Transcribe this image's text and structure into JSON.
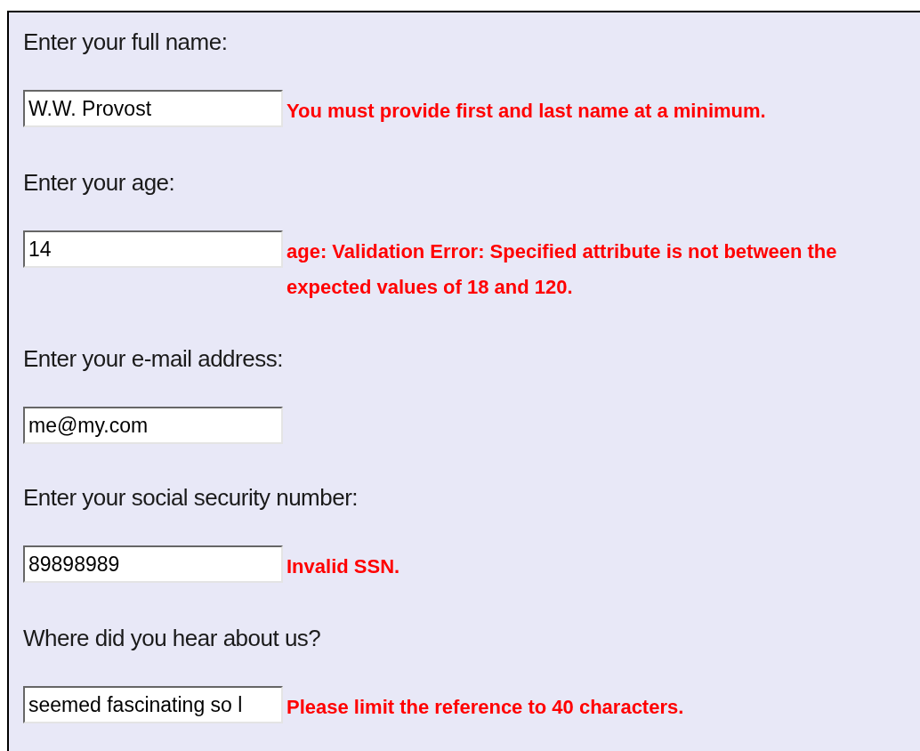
{
  "fields": [
    {
      "label": "Enter your full name:",
      "value": "W.W. Provost",
      "error": "You must provide first and last name at a minimum."
    },
    {
      "label": "Enter your age:",
      "value": "14",
      "error": "age: Validation Error: Specified attribute is not between the expected values of 18 and 120."
    },
    {
      "label": "Enter your e-mail address:",
      "value": "me@my.com"
    },
    {
      "label": "Enter your social security number:",
      "value": "89898989",
      "error": "Invalid SSN."
    },
    {
      "label": "Where did you hear about us?",
      "value": "seemed fascinating so l",
      "error": "Please limit the reference to 40 characters."
    }
  ]
}
